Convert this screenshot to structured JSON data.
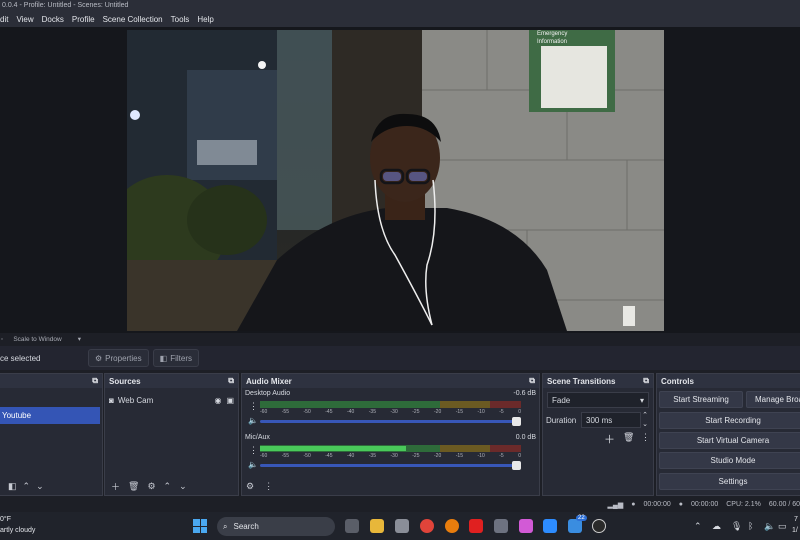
{
  "window": {
    "title": "0.0.4 - Profile: Untitled - Scenes: Untitled"
  },
  "menu": [
    "dit",
    "View",
    "Docks",
    "Profile",
    "Scene Collection",
    "Tools",
    "Help"
  ],
  "preview": {
    "sign_line1": "Emergency",
    "sign_line2": "Information"
  },
  "scale_bar": {
    "label": "Scale to Window"
  },
  "context_bar": {
    "no_source": "ce selected",
    "properties": "Properties",
    "filters": "Filters"
  },
  "scenes": {
    "item": "Youtube"
  },
  "sources": {
    "title": "Sources",
    "items": [
      {
        "name": "Web Cam"
      }
    ]
  },
  "mixer": {
    "title": "Audio Mixer",
    "ticks": [
      "-60",
      "-55",
      "-50",
      "-45",
      "-40",
      "-35",
      "-30",
      "-25",
      "-20",
      "-15",
      "-10",
      "-5",
      "0"
    ],
    "tracks": [
      {
        "name": "Desktop Audio",
        "db": "-0.6 dB",
        "level": 0.0
      },
      {
        "name": "Mic/Aux",
        "db": "0.0 dB",
        "level": 0.56
      }
    ]
  },
  "transitions": {
    "title": "Scene Transitions",
    "selected": "Fade",
    "duration_label": "Duration",
    "duration_value": "300 ms"
  },
  "controls": {
    "title": "Controls",
    "start_streaming": "Start Streaming",
    "manage_broadcast": "Manage Broa",
    "start_recording": "Start Recording",
    "start_virtual_camera": "Start Virtual Camera",
    "studio_mode": "Studio Mode",
    "settings": "Settings"
  },
  "status": {
    "stream_time": "00:00:00",
    "rec_time": "00:00:00",
    "cpu": "CPU: 2.1%",
    "fps": "60.00 / 60"
  },
  "taskbar": {
    "weather_temp": "0°F",
    "weather_desc": "artly cloudy",
    "search": "Search",
    "badge": "22",
    "time": "7",
    "date": "1/"
  },
  "colors": {
    "accent": "#3455b5",
    "meter_green": "#49c95a",
    "panel": "#272a35"
  }
}
